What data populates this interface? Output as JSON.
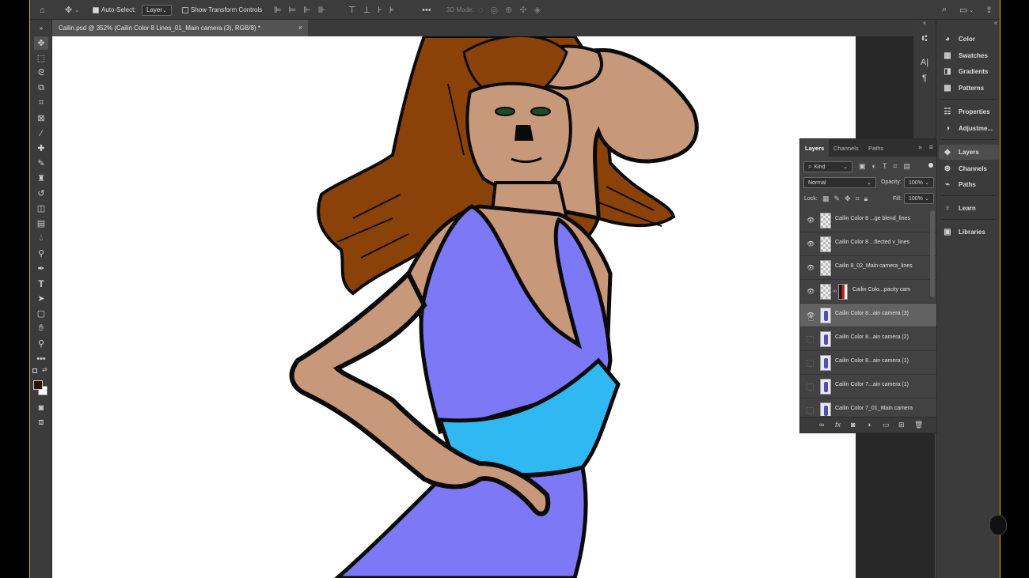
{
  "options_bar": {
    "auto_select_label": "Auto-Select:",
    "layer_select_value": "Layer",
    "transform_label": "Show Transform Controls",
    "mode_3d_label": "3D Mode:",
    "more_label": "•••"
  },
  "document_tab": {
    "title": "Cailin.psd @ 352% (Cailin Color 8 Lines_01_Main camera (3), RGB/8) *",
    "close_glyph": "×"
  },
  "right_panels": {
    "items": [
      {
        "label": "Color"
      },
      {
        "label": "Swatches"
      },
      {
        "label": "Gradients"
      },
      {
        "label": "Patterns"
      },
      {
        "label": "Properties"
      },
      {
        "label": "Adjustme..."
      },
      {
        "label": "Layers"
      },
      {
        "label": "Channels"
      },
      {
        "label": "Paths"
      },
      {
        "label": "Learn"
      },
      {
        "label": "Libraries"
      }
    ]
  },
  "layers_panel": {
    "tabs": [
      "Layers",
      "Channels",
      "Paths"
    ],
    "filter_kind": "Kind",
    "blend_mode": "Normal",
    "opacity_label": "Opacity:",
    "opacity_value": "100%",
    "lock_label": "Lock:",
    "fill_label": "Fill:",
    "fill_value": "100%",
    "layers": [
      {
        "name": "Cailin Color 8 ...ge blend_lines",
        "visible": true
      },
      {
        "name": "Cailin Color 8 ...flected v_lines",
        "visible": true
      },
      {
        "name": "Cailin 8_02_Main camera_lines",
        "visible": true
      },
      {
        "name": "Cailin Colo...pacity cam",
        "visible": true
      },
      {
        "name": "Cailin Color 8...ain camera (3)",
        "visible": true,
        "selected": true
      },
      {
        "name": "Cailin Color 8...ain camera (2)",
        "visible": false
      },
      {
        "name": "Cailin Color 8...ain camera (1)",
        "visible": false
      },
      {
        "name": "Cailin Color 7...ain camera (1)",
        "visible": false
      },
      {
        "name": "Cailin Color 7_01_Main camera",
        "visible": false
      }
    ]
  },
  "colors": {
    "skin": "#c8987a",
    "hair": "#8a4208",
    "dress": "#7d78f5",
    "band": "#2fb8f2",
    "outline": "#0a0a0a",
    "accent_border": "#d8b400"
  }
}
